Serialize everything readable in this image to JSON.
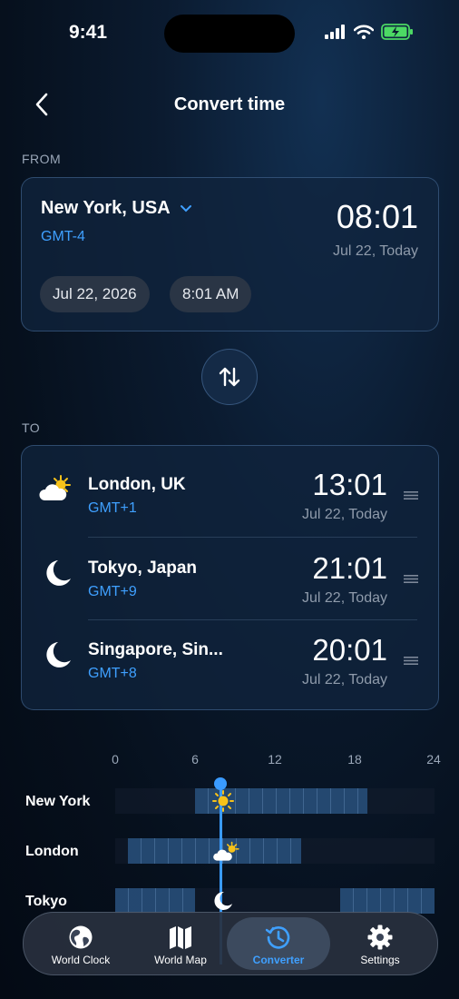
{
  "status": {
    "time": "9:41"
  },
  "header": {
    "title": "Convert time"
  },
  "from": {
    "section_label": "FROM",
    "city": "New York, USA",
    "gmt": "GMT-4",
    "time": "08:01",
    "date_label": "Jul 22, Today",
    "date_pill": "Jul 22, 2026",
    "time_pill": "8:01 AM"
  },
  "to": {
    "section_label": "TO",
    "rows": [
      {
        "city": "London, UK",
        "gmt": "GMT+1",
        "time": "13:01",
        "date_label": "Jul 22, Today",
        "icon": "partly-cloudy-sun-icon"
      },
      {
        "city": "Tokyo, Japan",
        "gmt": "GMT+9",
        "time": "21:01",
        "date_label": "Jul 22, Today",
        "icon": "moon-icon"
      },
      {
        "city": "Singapore, Sin...",
        "gmt": "GMT+8",
        "time": "20:01",
        "date_label": "Jul 22, Today",
        "icon": "moon-icon"
      }
    ]
  },
  "timeline": {
    "ticks": [
      "0",
      "6",
      "12",
      "18",
      "24"
    ],
    "rows": [
      {
        "label": "New York"
      },
      {
        "label": "London"
      },
      {
        "label": "Tokyo"
      }
    ]
  },
  "tabs": [
    {
      "label": "World Clock",
      "icon": "globe-icon"
    },
    {
      "label": "World Map",
      "icon": "map-icon"
    },
    {
      "label": "Converter",
      "icon": "history-clock-icon",
      "selected": true
    },
    {
      "label": "Settings",
      "icon": "gear-icon"
    }
  ],
  "colors": {
    "accent": "#3fa0ff",
    "background": "#06101d"
  }
}
